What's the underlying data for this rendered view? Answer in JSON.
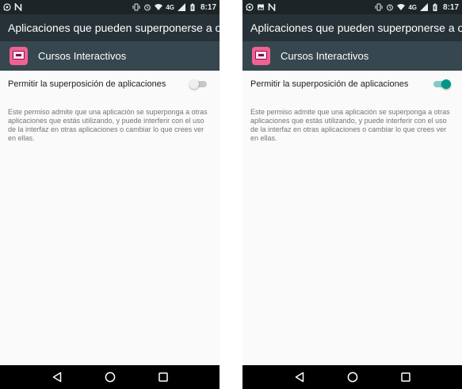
{
  "status_bar": {
    "time": "8:17",
    "network": "4G"
  },
  "screens": [
    {
      "title": "Aplicaciones que pueden superponerse a o...",
      "app_name": "Cursos Interactivos",
      "setting_label": "Permitir la superposición de aplicaciones",
      "toggle_on": false,
      "description": "Este permiso admite que una aplicación se superponga a otras aplicaciones que estás utilizando, y puede interferir con el uso de la interfaz en otras aplicaciones o cambiar lo que crees ver en ellas."
    },
    {
      "title": "Aplicaciones que pueden superponerse a o...",
      "app_name": "Cursos Interactivos",
      "setting_label": "Permitir la superposición de aplicaciones",
      "toggle_on": true,
      "description": "Este permiso admite que una aplicación se superponga a otras aplicaciones que estás utilizando, y puede interferir con el uso de la interfaz en otras aplicaciones o cambiar lo que crees ver en ellas."
    }
  ],
  "colors": {
    "status_bar": "#1d2426",
    "app_bar": "#263238",
    "app_row": "#37474f",
    "accent": "#009688",
    "app_icon": "#f06292"
  },
  "icons": {
    "status_left_screen1": [
      "whatsapp-icon",
      "n-notification-icon"
    ],
    "status_left_screen2": [
      "whatsapp-icon",
      "image-icon",
      "n-notification-icon"
    ],
    "status_right": [
      "vibrate-icon",
      "alarm-icon",
      "wifi-icon",
      "signal-icon",
      "battery-icon"
    ],
    "nav": [
      "back-icon",
      "home-icon",
      "recents-icon"
    ]
  }
}
